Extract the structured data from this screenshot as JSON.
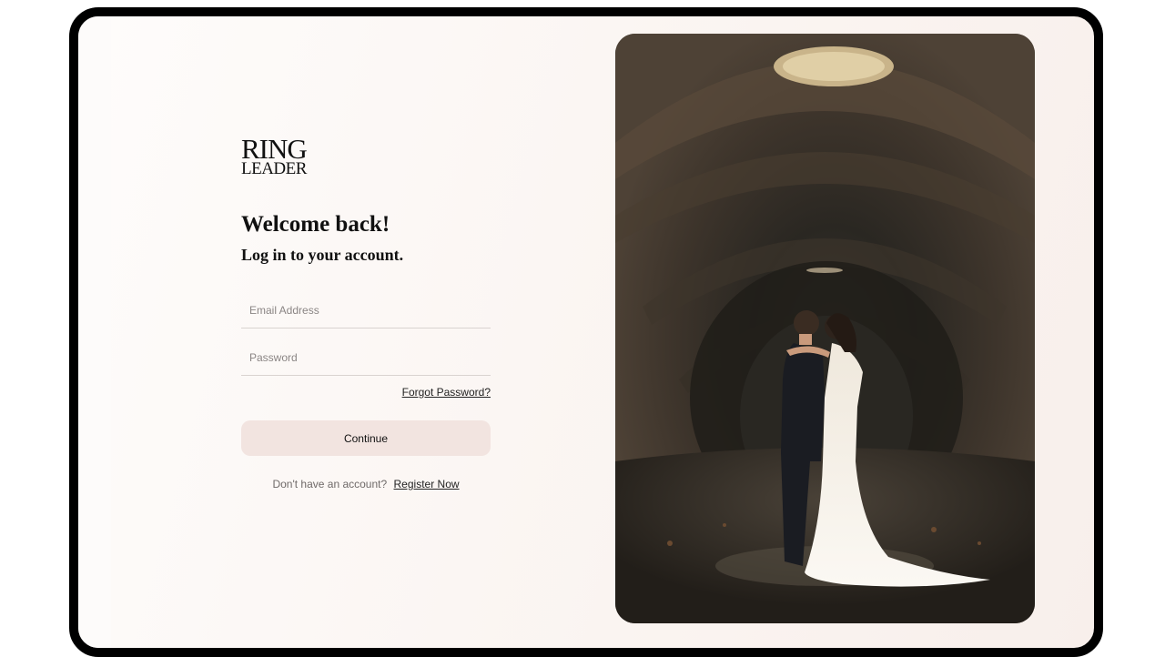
{
  "brand": {
    "line1": "RING",
    "line2": "LEADER"
  },
  "login": {
    "welcome": "Welcome back!",
    "subtitle": "Log in to your account.",
    "email_placeholder": "Email Address",
    "password_placeholder": "Password",
    "forgot_label": "Forgot Password?",
    "continue_label": "Continue",
    "no_account_text": "Don't have an account?",
    "register_label": "Register Now"
  },
  "colors": {
    "button_bg": "#f2e4e0",
    "page_bg": "#fbf6f3"
  }
}
